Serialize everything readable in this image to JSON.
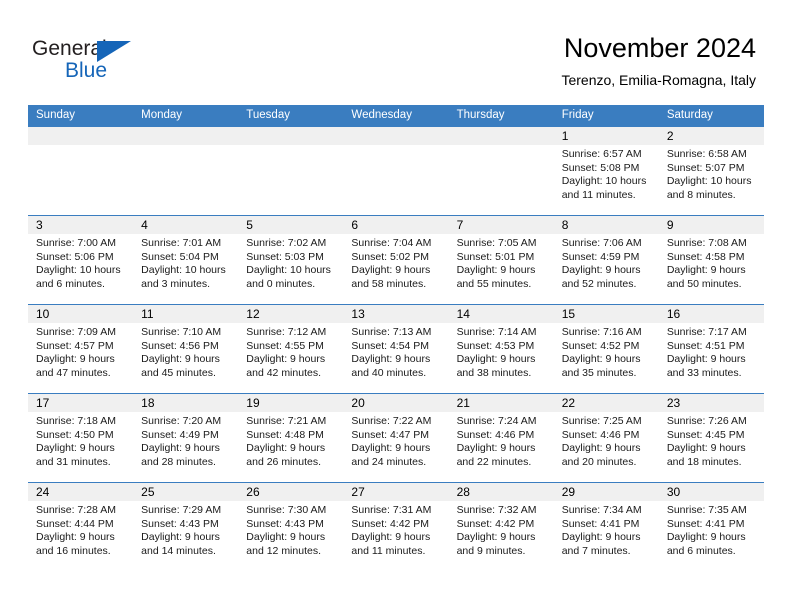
{
  "brand": {
    "name_top": "General",
    "name_bottom": "Blue",
    "color_blue": "#1565b8",
    "color_dark": "#231f20"
  },
  "header": {
    "title": "November 2024",
    "subtitle": "Terenzo, Emilia-Romagna, Italy"
  },
  "theme": {
    "header_blue": "#3a7dc0",
    "daynum_band": "#f0f0f0",
    "text": "#000000"
  },
  "weekdays": [
    "Sunday",
    "Monday",
    "Tuesday",
    "Wednesday",
    "Thursday",
    "Friday",
    "Saturday"
  ],
  "weeks": [
    [
      {
        "empty": true
      },
      {
        "empty": true
      },
      {
        "empty": true
      },
      {
        "empty": true
      },
      {
        "empty": true
      },
      {
        "day": "1",
        "sunrise": "Sunrise: 6:57 AM",
        "sunset": "Sunset: 5:08 PM",
        "daylight1": "Daylight: 10 hours",
        "daylight2": "and 11 minutes."
      },
      {
        "day": "2",
        "sunrise": "Sunrise: 6:58 AM",
        "sunset": "Sunset: 5:07 PM",
        "daylight1": "Daylight: 10 hours",
        "daylight2": "and 8 minutes."
      }
    ],
    [
      {
        "day": "3",
        "sunrise": "Sunrise: 7:00 AM",
        "sunset": "Sunset: 5:06 PM",
        "daylight1": "Daylight: 10 hours",
        "daylight2": "and 6 minutes."
      },
      {
        "day": "4",
        "sunrise": "Sunrise: 7:01 AM",
        "sunset": "Sunset: 5:04 PM",
        "daylight1": "Daylight: 10 hours",
        "daylight2": "and 3 minutes."
      },
      {
        "day": "5",
        "sunrise": "Sunrise: 7:02 AM",
        "sunset": "Sunset: 5:03 PM",
        "daylight1": "Daylight: 10 hours",
        "daylight2": "and 0 minutes."
      },
      {
        "day": "6",
        "sunrise": "Sunrise: 7:04 AM",
        "sunset": "Sunset: 5:02 PM",
        "daylight1": "Daylight: 9 hours",
        "daylight2": "and 58 minutes."
      },
      {
        "day": "7",
        "sunrise": "Sunrise: 7:05 AM",
        "sunset": "Sunset: 5:01 PM",
        "daylight1": "Daylight: 9 hours",
        "daylight2": "and 55 minutes."
      },
      {
        "day": "8",
        "sunrise": "Sunrise: 7:06 AM",
        "sunset": "Sunset: 4:59 PM",
        "daylight1": "Daylight: 9 hours",
        "daylight2": "and 52 minutes."
      },
      {
        "day": "9",
        "sunrise": "Sunrise: 7:08 AM",
        "sunset": "Sunset: 4:58 PM",
        "daylight1": "Daylight: 9 hours",
        "daylight2": "and 50 minutes."
      }
    ],
    [
      {
        "day": "10",
        "sunrise": "Sunrise: 7:09 AM",
        "sunset": "Sunset: 4:57 PM",
        "daylight1": "Daylight: 9 hours",
        "daylight2": "and 47 minutes."
      },
      {
        "day": "11",
        "sunrise": "Sunrise: 7:10 AM",
        "sunset": "Sunset: 4:56 PM",
        "daylight1": "Daylight: 9 hours",
        "daylight2": "and 45 minutes."
      },
      {
        "day": "12",
        "sunrise": "Sunrise: 7:12 AM",
        "sunset": "Sunset: 4:55 PM",
        "daylight1": "Daylight: 9 hours",
        "daylight2": "and 42 minutes."
      },
      {
        "day": "13",
        "sunrise": "Sunrise: 7:13 AM",
        "sunset": "Sunset: 4:54 PM",
        "daylight1": "Daylight: 9 hours",
        "daylight2": "and 40 minutes."
      },
      {
        "day": "14",
        "sunrise": "Sunrise: 7:14 AM",
        "sunset": "Sunset: 4:53 PM",
        "daylight1": "Daylight: 9 hours",
        "daylight2": "and 38 minutes."
      },
      {
        "day": "15",
        "sunrise": "Sunrise: 7:16 AM",
        "sunset": "Sunset: 4:52 PM",
        "daylight1": "Daylight: 9 hours",
        "daylight2": "and 35 minutes."
      },
      {
        "day": "16",
        "sunrise": "Sunrise: 7:17 AM",
        "sunset": "Sunset: 4:51 PM",
        "daylight1": "Daylight: 9 hours",
        "daylight2": "and 33 minutes."
      }
    ],
    [
      {
        "day": "17",
        "sunrise": "Sunrise: 7:18 AM",
        "sunset": "Sunset: 4:50 PM",
        "daylight1": "Daylight: 9 hours",
        "daylight2": "and 31 minutes."
      },
      {
        "day": "18",
        "sunrise": "Sunrise: 7:20 AM",
        "sunset": "Sunset: 4:49 PM",
        "daylight1": "Daylight: 9 hours",
        "daylight2": "and 28 minutes."
      },
      {
        "day": "19",
        "sunrise": "Sunrise: 7:21 AM",
        "sunset": "Sunset: 4:48 PM",
        "daylight1": "Daylight: 9 hours",
        "daylight2": "and 26 minutes."
      },
      {
        "day": "20",
        "sunrise": "Sunrise: 7:22 AM",
        "sunset": "Sunset: 4:47 PM",
        "daylight1": "Daylight: 9 hours",
        "daylight2": "and 24 minutes."
      },
      {
        "day": "21",
        "sunrise": "Sunrise: 7:24 AM",
        "sunset": "Sunset: 4:46 PM",
        "daylight1": "Daylight: 9 hours",
        "daylight2": "and 22 minutes."
      },
      {
        "day": "22",
        "sunrise": "Sunrise: 7:25 AM",
        "sunset": "Sunset: 4:46 PM",
        "daylight1": "Daylight: 9 hours",
        "daylight2": "and 20 minutes."
      },
      {
        "day": "23",
        "sunrise": "Sunrise: 7:26 AM",
        "sunset": "Sunset: 4:45 PM",
        "daylight1": "Daylight: 9 hours",
        "daylight2": "and 18 minutes."
      }
    ],
    [
      {
        "day": "24",
        "sunrise": "Sunrise: 7:28 AM",
        "sunset": "Sunset: 4:44 PM",
        "daylight1": "Daylight: 9 hours",
        "daylight2": "and 16 minutes."
      },
      {
        "day": "25",
        "sunrise": "Sunrise: 7:29 AM",
        "sunset": "Sunset: 4:43 PM",
        "daylight1": "Daylight: 9 hours",
        "daylight2": "and 14 minutes."
      },
      {
        "day": "26",
        "sunrise": "Sunrise: 7:30 AM",
        "sunset": "Sunset: 4:43 PM",
        "daylight1": "Daylight: 9 hours",
        "daylight2": "and 12 minutes."
      },
      {
        "day": "27",
        "sunrise": "Sunrise: 7:31 AM",
        "sunset": "Sunset: 4:42 PM",
        "daylight1": "Daylight: 9 hours",
        "daylight2": "and 11 minutes."
      },
      {
        "day": "28",
        "sunrise": "Sunrise: 7:32 AM",
        "sunset": "Sunset: 4:42 PM",
        "daylight1": "Daylight: 9 hours",
        "daylight2": "and 9 minutes."
      },
      {
        "day": "29",
        "sunrise": "Sunrise: 7:34 AM",
        "sunset": "Sunset: 4:41 PM",
        "daylight1": "Daylight: 9 hours",
        "daylight2": "and 7 minutes."
      },
      {
        "day": "30",
        "sunrise": "Sunrise: 7:35 AM",
        "sunset": "Sunset: 4:41 PM",
        "daylight1": "Daylight: 9 hours",
        "daylight2": "and 6 minutes."
      }
    ]
  ]
}
